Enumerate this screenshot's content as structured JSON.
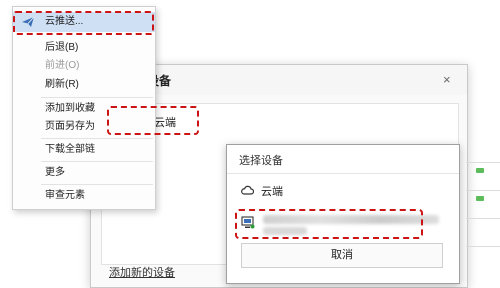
{
  "context_menu": {
    "items": [
      {
        "label": "云推送...",
        "highlighted": true
      },
      {
        "label": "后退(B)"
      },
      {
        "label": "前进(O)",
        "disabled": true
      },
      {
        "label": "刷新(R)"
      },
      {
        "label": "添加到收藏"
      },
      {
        "label": "页面另存为"
      },
      {
        "label": "下载全部链"
      },
      {
        "label": "更多"
      },
      {
        "label": "审查元素"
      }
    ]
  },
  "dialog": {
    "title": "选择设备",
    "close_icon": "×",
    "selected_option": "云端",
    "add_device_link": "添加新的设备"
  },
  "device_panel": {
    "title": "选择设备",
    "cloud_option": "云端",
    "cancel_label": "取消"
  },
  "colors": {
    "highlight_dash": "#cc1414",
    "menu_highlight": "#cfe0f5",
    "accent_blue": "#3b6fb6",
    "cloud_green": "#2e9a3a"
  },
  "icons": {
    "send": "paper-plane-icon",
    "cloud": "cloud-icon",
    "device": "computer-icon",
    "checkbox": "checkbox-icon"
  }
}
